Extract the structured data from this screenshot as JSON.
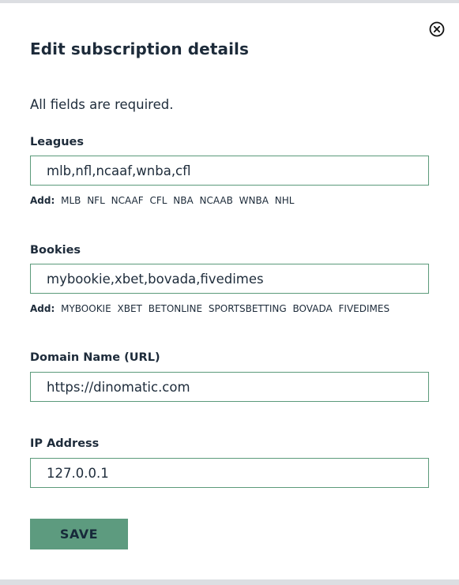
{
  "modal": {
    "title": "Edit subscription details",
    "required_note": "All fields are required.",
    "close_icon": "close-circle-icon"
  },
  "leagues": {
    "label": "Leagues",
    "value": "mlb,nfl,ncaaf,wnba,cfl",
    "add_label": "Add:",
    "options": [
      "MLB",
      "NFL",
      "NCAAF",
      "CFL",
      "NBA",
      "NCAAB",
      "WNBA",
      "NHL"
    ]
  },
  "bookies": {
    "label": "Bookies",
    "value": "mybookie,xbet,bovada,fivedimes",
    "add_label": "Add:",
    "options": [
      "MYBOOKIE",
      "XBET",
      "BETONLINE",
      "SPORTSBETTING",
      "BOVADA",
      "FIVEDIMES"
    ]
  },
  "domain": {
    "label": "Domain Name (URL)",
    "value": "https://dinomatic.com"
  },
  "ip": {
    "label": "IP Address",
    "value": "127.0.0.1"
  },
  "actions": {
    "save_label": "SAVE"
  },
  "colors": {
    "accent": "#5d9b7f",
    "border": "#5b9a7a",
    "text": "#1d2b3a"
  }
}
